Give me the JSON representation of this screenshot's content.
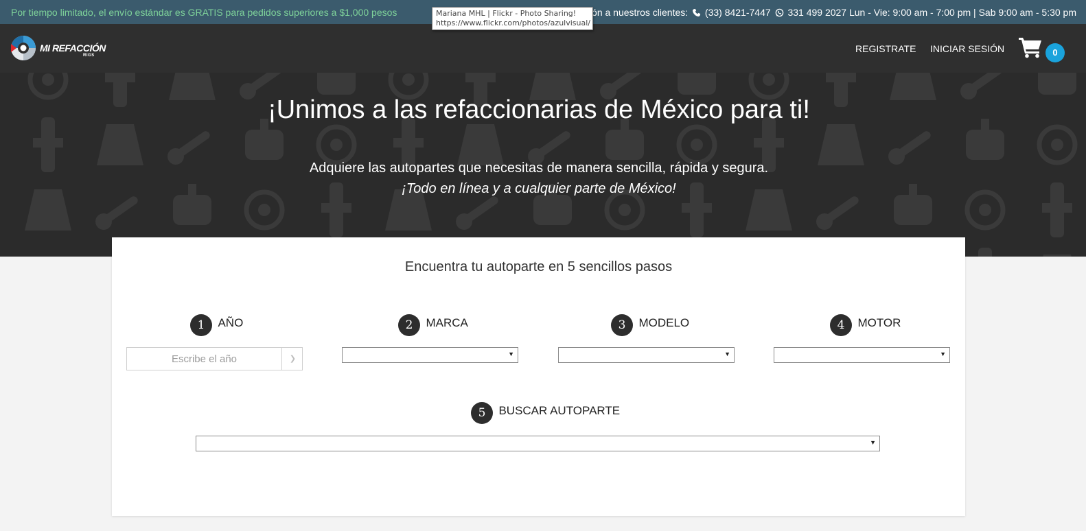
{
  "topbar": {
    "promo": "Por tiempo limitado, el envío estándar es GRATIS para pedidos superiores a $1,000 pesos",
    "contact_prefix": "ción a nuestros clientes:",
    "phone": "(33) 8421-7447",
    "whatsapp": "331 499 2027",
    "hours": "Lun - Vie: 9:00 am - 7:00 pm | Sab 9:00 am - 5:30 pm",
    "phone_icon": "phone-icon",
    "whatsapp_icon": "whatsapp-icon"
  },
  "tooltip": {
    "line1": "Mariana MHL | Flickr - Photo Sharing!",
    "line2": "https://www.flickr.com/photos/azulvisual/"
  },
  "navbar": {
    "logo_text": "MI REFACCIÓN",
    "logo_sub": "RIGS",
    "register": "REGISTRATE",
    "login": "INICIAR SESIÓN",
    "cart_icon": "cart-icon",
    "cart_count": "0"
  },
  "hero": {
    "title": "¡Unimos a las refaccionarias de México para ti!",
    "subtitle": "Adquiere las autopartes que necesitas de manera sencilla, rápida y segura.",
    "subtitle2": "¡Todo en línea y a cualquier parte de México!"
  },
  "finder": {
    "title": "Encuentra tu autoparte en 5 sencillos pasos",
    "steps": [
      {
        "num": "1",
        "label": "AÑO"
      },
      {
        "num": "2",
        "label": "MARCA"
      },
      {
        "num": "3",
        "label": "MODELO"
      },
      {
        "num": "4",
        "label": "MOTOR"
      },
      {
        "num": "5",
        "label": "BUSCAR AUTOPARTE"
      }
    ],
    "year_placeholder": "Escribe el año",
    "year_value": "",
    "marca_value": "",
    "modelo_value": "",
    "motor_value": "",
    "autoparte_value": ""
  },
  "colors": {
    "topbar": "#3b5b6d",
    "promo_text": "#7fd39a",
    "navbar": "#2f2f2f",
    "hero": "#2b2b2b",
    "badge": "#1aa3dc",
    "page_bg": "#f3f3f3"
  }
}
